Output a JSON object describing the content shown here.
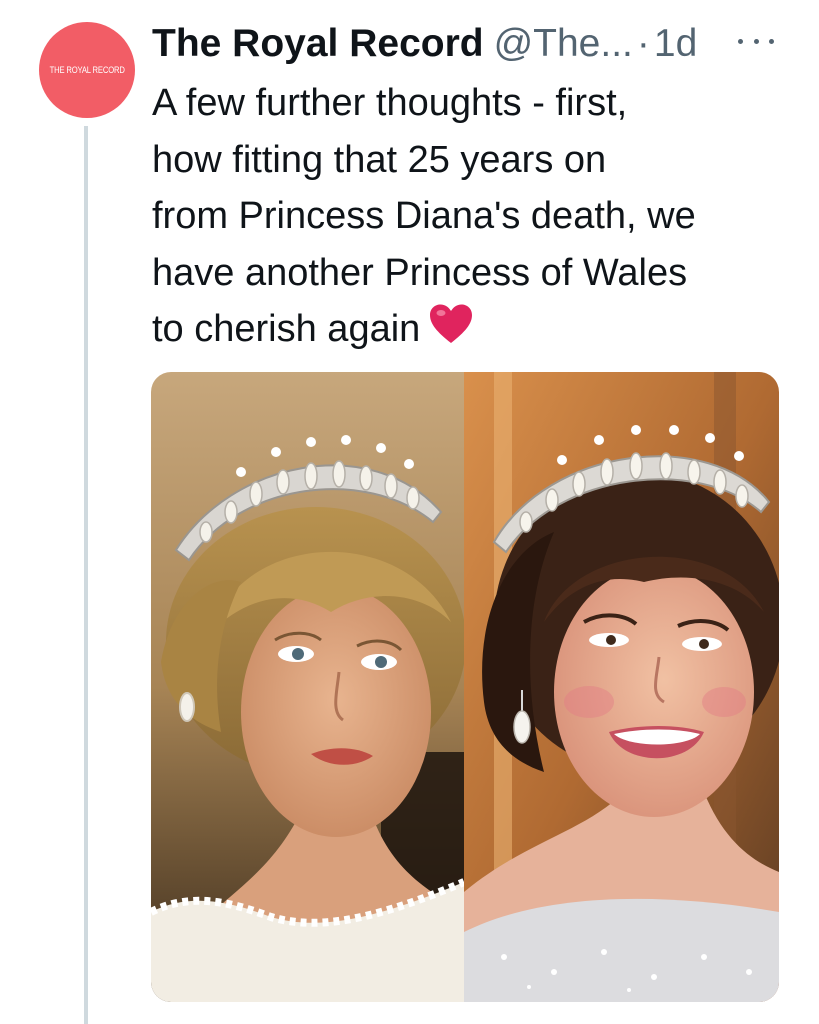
{
  "tweet": {
    "avatar": {
      "text": "THE ROYAL RECORD",
      "color": "#f25d66"
    },
    "author": {
      "display_name": "The Royal Record",
      "handle": "@The...",
      "separator": "·",
      "time": "1d"
    },
    "text_lines": [
      "A few further thoughts - first,",
      "how fitting that 25 years on",
      "from Princess Diana's death, we",
      "have another Princess of Wales",
      "to cherish again"
    ],
    "emoji": "heart-icon",
    "media": {
      "photos": [
        {
          "subject": "woman-with-tiara-left"
        },
        {
          "subject": "woman-with-tiara-right"
        }
      ]
    }
  },
  "colors": {
    "text": "#0f1419",
    "secondary": "#536471",
    "thread_line": "#cfd9de",
    "heart": "#e0245e"
  }
}
